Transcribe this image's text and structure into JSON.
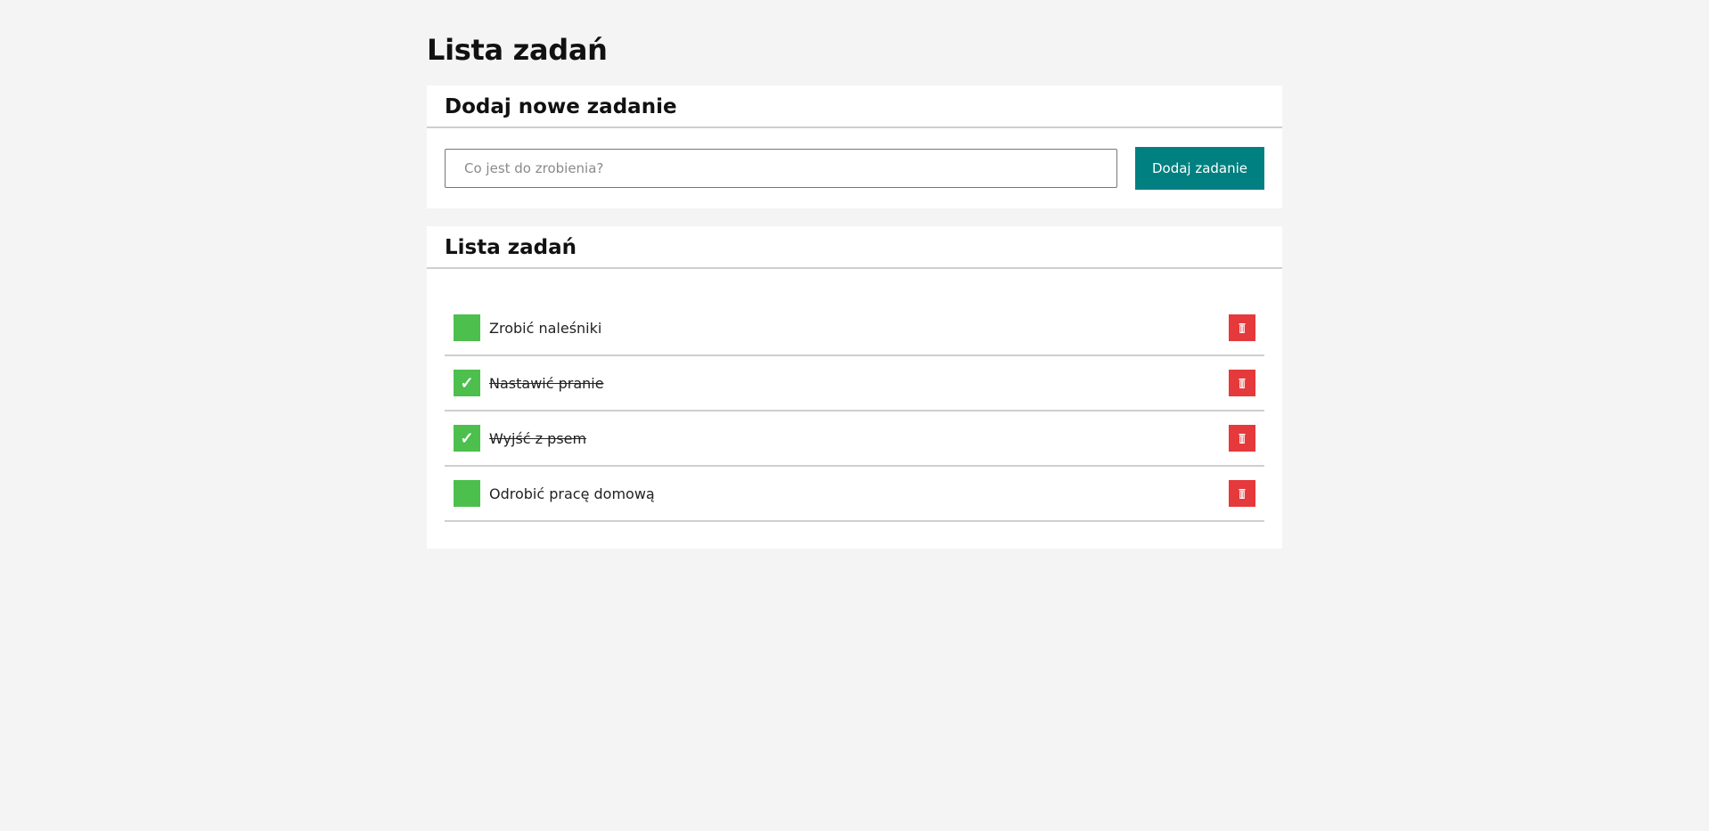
{
  "page": {
    "title": "Lista zadań"
  },
  "add_section": {
    "heading": "Dodaj nowe zadanie",
    "input_placeholder": "Co jest do zrobienia?",
    "input_value": "",
    "button_label": "Dodaj zadanie"
  },
  "list_section": {
    "heading": "Lista zadań",
    "tasks": [
      {
        "text": "Zrobić naleśniki",
        "done": false,
        "check_glyph": ""
      },
      {
        "text": "Nastawić pranie",
        "done": true,
        "check_glyph": "✓"
      },
      {
        "text": "Wyjść z psem",
        "done": true,
        "check_glyph": "✓"
      },
      {
        "text": "Odrobić pracę domową",
        "done": false,
        "check_glyph": ""
      }
    ]
  },
  "icons": {
    "check": "check-icon",
    "delete": "trash-icon"
  },
  "colors": {
    "background": "#f4f4f4",
    "card": "#ffffff",
    "accent": "#008080",
    "checkbox": "#4cbf4d",
    "delete": "#e5393c",
    "divider": "#cfcfcf"
  }
}
